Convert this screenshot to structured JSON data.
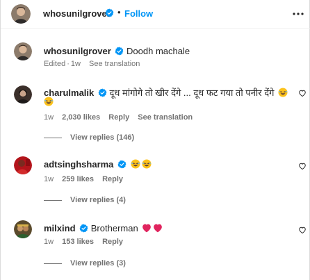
{
  "post_header": {
    "username": "whosunilgrover",
    "separator": "•",
    "follow_label": "Follow"
  },
  "caption": {
    "username": "whosunilgrover",
    "text": "Doodh machale",
    "edited_label": "Edited",
    "dot": "·",
    "time": "1w",
    "see_translation": "See translation"
  },
  "comments": [
    {
      "username": "charulmalik",
      "text": "दूध मांगोगे तो खीर देंगे ... दूध फट गया तो पनीर देंगे",
      "time": "1w",
      "likes": "2,030 likes",
      "reply_label": "Reply",
      "see_translation": "See translation",
      "view_replies": "View replies (146)",
      "avatar_color": "#3b2f2a",
      "emojis": [
        "laughing-emoji",
        "laughing-emoji"
      ]
    },
    {
      "username": "adtsinghsharma",
      "text": "",
      "time": "1w",
      "likes": "259 likes",
      "reply_label": "Reply",
      "view_replies": "View replies (4)",
      "avatar_color": "#b3141b",
      "emojis": [
        "laughing-emoji",
        "laughing-emoji"
      ]
    },
    {
      "username": "milxind",
      "text": "Brotherman",
      "time": "1w",
      "likes": "153 likes",
      "reply_label": "Reply",
      "view_replies": "View replies (3)",
      "avatar_color": "#5a4a2c",
      "emojis": [
        "red-heart-emoji",
        "red-heart-emoji"
      ]
    }
  ],
  "colors": {
    "accent": "#0095f6",
    "verified": "#0095f6",
    "muted_text": "#737373",
    "text": "#262626",
    "heart_red": "#e0245e"
  }
}
